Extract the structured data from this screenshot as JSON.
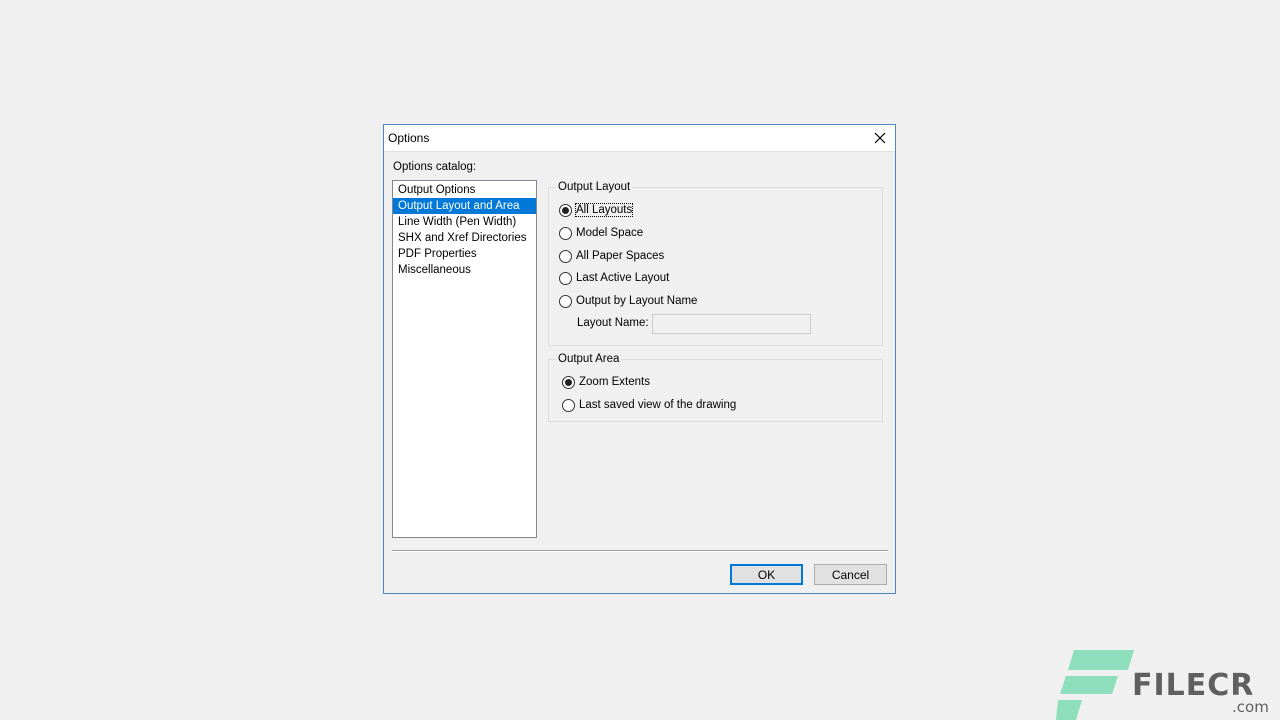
{
  "window": {
    "title": "Options"
  },
  "catalog": {
    "label": "Options catalog:",
    "items": [
      {
        "label": "Output Options",
        "selected": false
      },
      {
        "label": "Output Layout and Area",
        "selected": true
      },
      {
        "label": "Line Width (Pen Width)",
        "selected": false
      },
      {
        "label": "SHX and Xref Directories",
        "selected": false
      },
      {
        "label": "PDF Properties",
        "selected": false
      },
      {
        "label": "Miscellaneous",
        "selected": false
      }
    ]
  },
  "output_layout": {
    "legend": "Output Layout",
    "options": [
      {
        "label": "All Layouts",
        "checked": true
      },
      {
        "label": "Model Space",
        "checked": false
      },
      {
        "label": "All Paper Spaces",
        "checked": false
      },
      {
        "label": "Last Active Layout",
        "checked": false
      },
      {
        "label": "Output by Layout Name",
        "checked": false
      }
    ],
    "layout_name_label": "Layout Name:",
    "layout_name_value": ""
  },
  "output_area": {
    "legend": "Output Area",
    "options": [
      {
        "label": "Zoom Extents",
        "checked": true
      },
      {
        "label": "Last saved view of the drawing",
        "checked": false
      }
    ]
  },
  "buttons": {
    "ok": "OK",
    "cancel": "Cancel"
  },
  "watermark": {
    "brand": "FILECR",
    "suffix": ".com",
    "accent_color": "#3ccf8e"
  },
  "icons": {
    "close": "close-icon",
    "logo": "filecr-logo-icon"
  }
}
